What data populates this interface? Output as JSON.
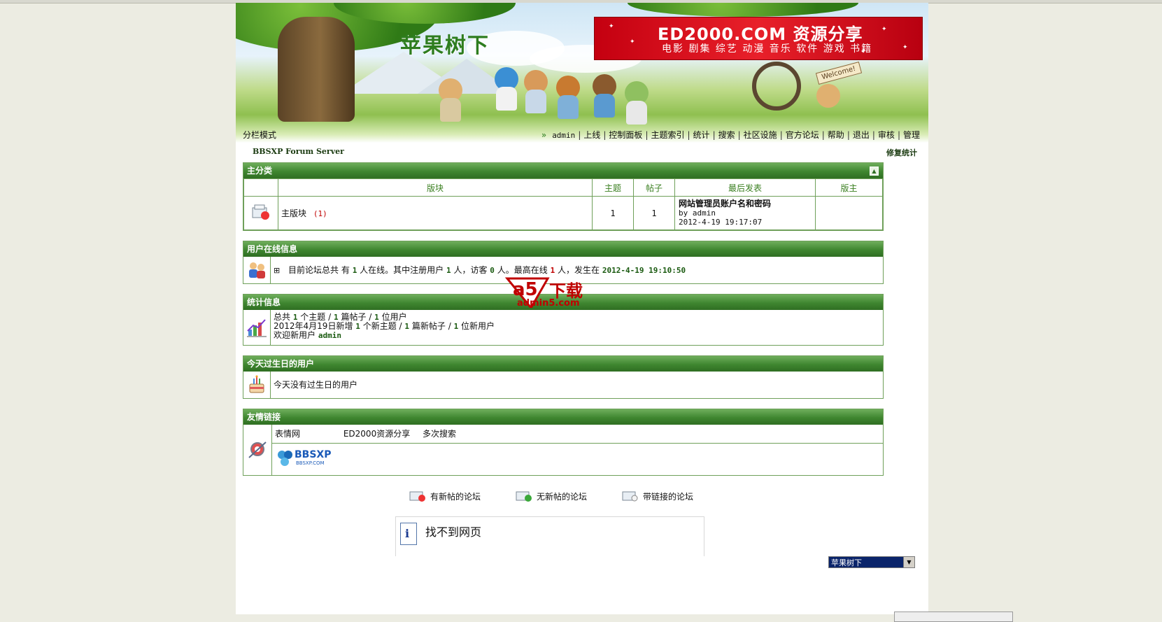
{
  "banner": {
    "site_logo": "苹果树下",
    "ad_title": "ED2000.COM 资源分享",
    "ad_subtitle": "电影 剧集 综艺 动漫 音乐 软件 游戏 书籍",
    "welcome_sign": "Welcome!"
  },
  "nav": {
    "mode": "分栏模式",
    "links": [
      "admin",
      "上线",
      "控制面板",
      "主题索引",
      "统计",
      "搜索",
      "社区设施",
      "官方论坛",
      "帮助",
      "退出",
      "审核",
      "管理"
    ]
  },
  "subbar": {
    "server_name": "BBSXP Forum Server",
    "repair": "修复统计"
  },
  "category": {
    "title": "主分类",
    "collapse": "▲",
    "columns": [
      "版块",
      "主题",
      "帖子",
      "最后发表",
      "版主"
    ],
    "forum": {
      "name": "主版块",
      "count": "(1)",
      "topics": "1",
      "posts": "1",
      "last_title": "网站管理员账户名和密码",
      "last_by": "by admin",
      "last_time": "2012-4-19 19:17:07",
      "moderator": ""
    }
  },
  "online": {
    "title": "用户在线信息",
    "expander": "⊞",
    "p1": "目前论坛总共 有",
    "total": "1",
    "p2": "人在线。其中注册用户",
    "registered": "1",
    "p3": "人，访客",
    "guests": "0",
    "p4": "人。最高在线",
    "peak": "1",
    "p5": "人，发生在",
    "peak_time": "2012-4-19 19:10:50"
  },
  "stats": {
    "title": "统计信息",
    "l1a": "总共",
    "topics": "1",
    "l1b": "个主题 /",
    "posts": "1",
    "l1c": "篇帖子 /",
    "users": "1",
    "l1d": "位用户",
    "l2a": "2012年4月19日新增",
    "new_topics": "1",
    "l2b": "个新主题 /",
    "new_posts": "1",
    "l2c": "篇新帖子 /",
    "new_users": "1",
    "l2d": "位新用户",
    "l3a": "欢迎新用户",
    "newest_user": "admin"
  },
  "birthday": {
    "title": "今天过生日的用户",
    "text": "今天没有过生日的用户"
  },
  "links": {
    "title": "友情链接",
    "items": [
      "表情网",
      "ED2000资源分享",
      "多次搜索"
    ],
    "logo_text": "BBSXP",
    "logo_sub": "BBSXP.COM"
  },
  "legend": {
    "new": "有新帖的论坛",
    "none": "无新帖的论坛",
    "link": "带链接的论坛"
  },
  "error_panel": {
    "title": "找不到网页"
  },
  "forum_select": {
    "value": "苹果树下"
  },
  "watermark": {
    "brand": "a5",
    "text": "下载",
    "url": "admin5.com"
  },
  "colors": {
    "header_green": "#3f8630",
    "border_green": "#6fa05a",
    "accent_red": "#c00000",
    "page_bg": "#ecece2"
  }
}
